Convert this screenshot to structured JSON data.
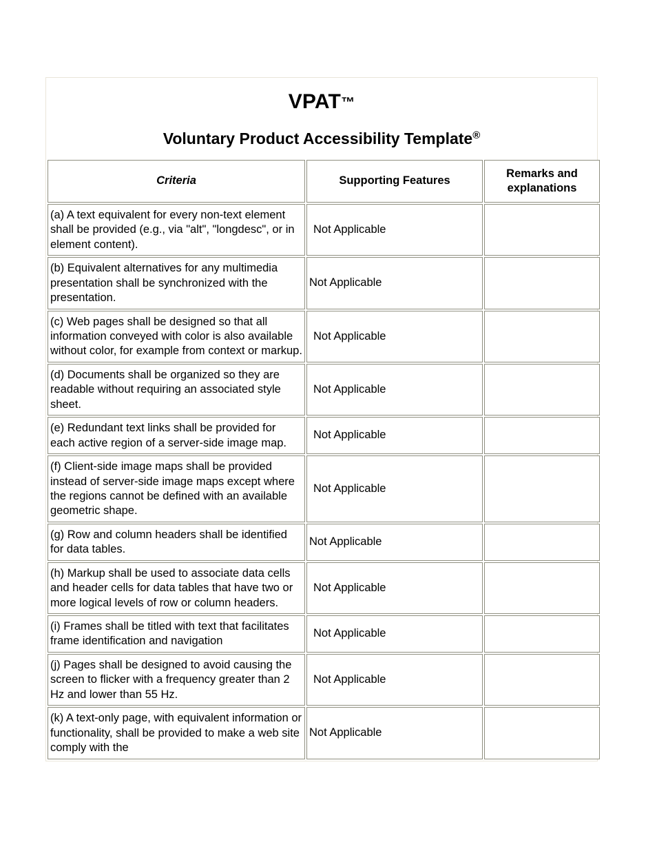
{
  "document": {
    "title": "VPAT",
    "title_tm": "™",
    "subtitle": "Voluntary Product Accessibility Template",
    "subtitle_reg": "®"
  },
  "table": {
    "headers": {
      "criteria": "Criteria",
      "supporting_features": "Supporting Features",
      "remarks": "Remarks and explanations"
    },
    "rows": [
      {
        "criteria": "(a) A text equivalent for every non-text element shall be provided (e.g., via \"alt\", \"longdesc\", or in element content).",
        "supporting_features": "Not Applicable",
        "supporting_indent": true,
        "remarks": ""
      },
      {
        "criteria": "(b) Equivalent alternatives for any multimedia presentation shall be synchronized with the presentation.",
        "supporting_features": "Not Applicable",
        "supporting_indent": false,
        "remarks": ""
      },
      {
        "criteria": "(c) Web pages shall be designed so that all information conveyed with color is also available without color, for example from context or markup.",
        "supporting_features": "Not Applicable",
        "supporting_indent": true,
        "remarks": ""
      },
      {
        "criteria": "(d) Documents shall be organized so they are readable without requiring an associated style sheet.",
        "supporting_features": "Not Applicable",
        "supporting_indent": true,
        "remarks": ""
      },
      {
        "criteria": "(e) Redundant text links shall be provided for each active region of a server-side image map.",
        "supporting_features": "Not Applicable",
        "supporting_indent": true,
        "remarks": ""
      },
      {
        "criteria": "(f) Client-side image maps shall be provided instead of server-side image maps except where the regions cannot be defined with an available geometric shape.",
        "supporting_features": "Not Applicable",
        "supporting_indent": true,
        "remarks": ""
      },
      {
        "criteria": "(g) Row and column headers shall be identified for data tables.",
        "supporting_features": "Not Applicable",
        "supporting_indent": false,
        "remarks": ""
      },
      {
        "criteria": "(h) Markup shall be used to associate data cells and header cells for data tables that have two or more logical levels of row or column headers.",
        "supporting_features": "Not Applicable",
        "supporting_indent": true,
        "remarks": ""
      },
      {
        "criteria": "(i) Frames shall be titled with text that facilitates frame identification and navigation",
        "supporting_features": "Not Applicable",
        "supporting_indent": true,
        "remarks": ""
      },
      {
        "criteria": "(j) Pages shall be designed to avoid causing the screen to flicker with a frequency greater than 2 Hz and lower than 55 Hz.",
        "supporting_features": "Not Applicable",
        "supporting_indent": true,
        "remarks": ""
      },
      {
        "criteria": "(k) A text-only page, with equivalent information or functionality, shall be provided to make a web site comply with the",
        "supporting_features": "Not Applicable",
        "supporting_indent": false,
        "remarks": ""
      }
    ]
  },
  "colors": {
    "page_background": "#ffffff",
    "outer_border": "#e9e5d9",
    "cell_border": "#8f8f80",
    "text": "#000000"
  }
}
